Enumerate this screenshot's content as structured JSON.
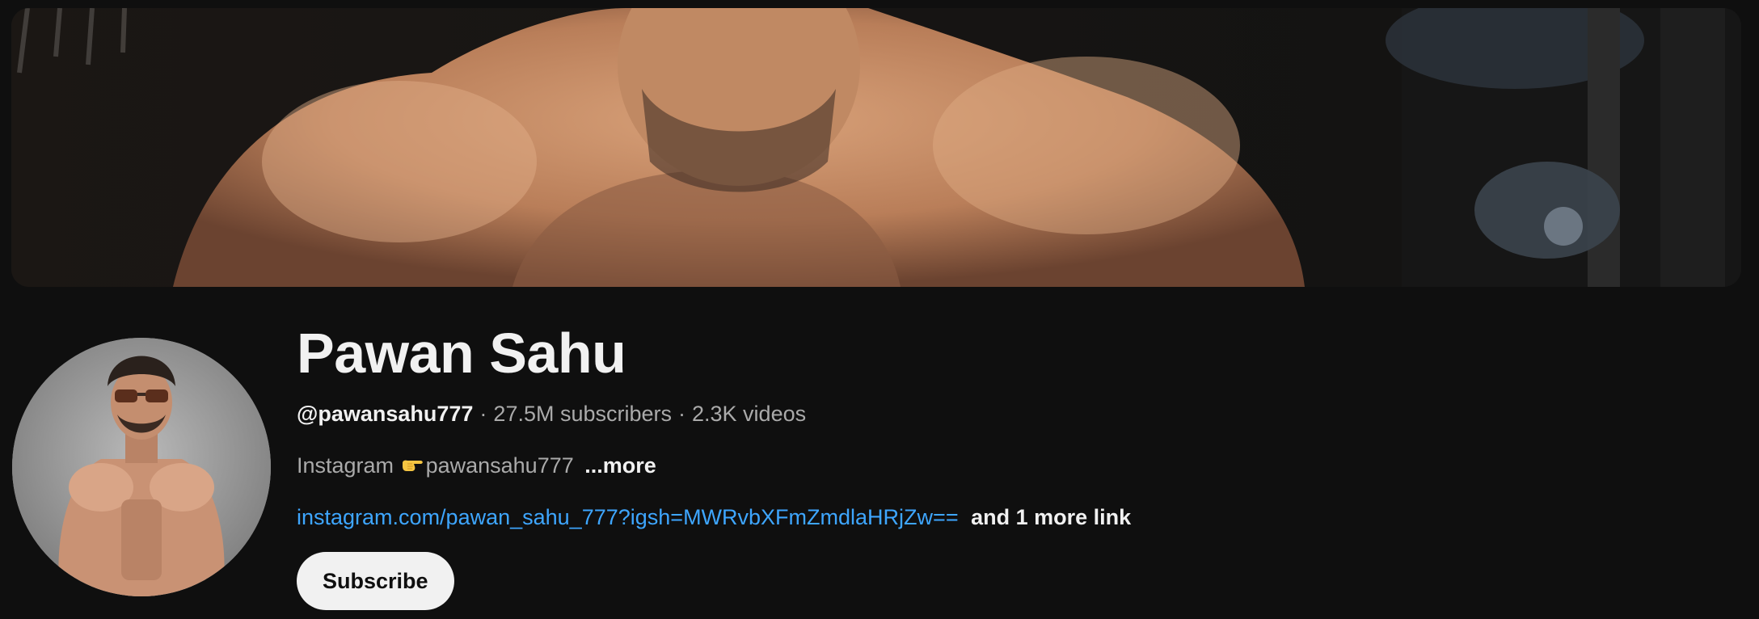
{
  "channel": {
    "name": "Pawan Sahu",
    "handle": "@pawansahu777",
    "subscribers": "27.5M subscribers",
    "videos": "2.3K videos",
    "separator": "·"
  },
  "description": {
    "prefix": "Instagram",
    "emoji_icon": "pointing-right-hand-icon",
    "text": "pawansahu777",
    "more_label": "...more"
  },
  "links": {
    "primary": "instagram.com/pawan_sahu_777?igsh=MWRvbXFmZmdlaHRjZw==",
    "more_label": "and 1 more link"
  },
  "actions": {
    "subscribe_label": "Subscribe"
  },
  "colors": {
    "background": "#0f0f0f",
    "link": "#3ea6ff",
    "primary_text": "#f1f1f1",
    "secondary_text": "#aaaaaa",
    "subscribe_bg": "#f1f1f1"
  }
}
